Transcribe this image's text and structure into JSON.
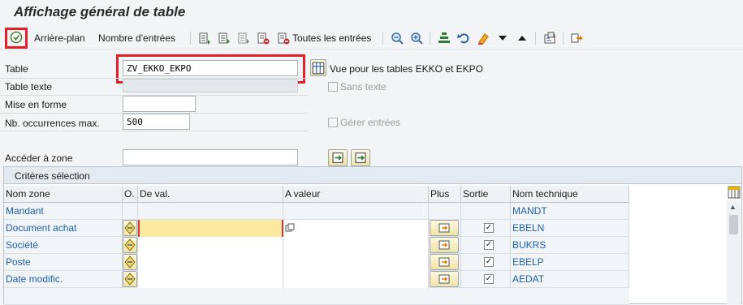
{
  "title": "Affichage général de table",
  "toolbar": {
    "background": "Arrière-plan",
    "entry_count": "Nombre d'entrées",
    "all_entries": "Toutes les entrées"
  },
  "form": {
    "table_label": "Table",
    "table_value": "ZV_EKKO_EKPO",
    "table_description": "Vue pour les tables EKKO et EKPO",
    "table_text_label": "Table texte",
    "no_text_label": "Sans texte",
    "layout_label": "Mise en forme",
    "layout_value": "",
    "max_hits_label": "Nb. occurrences max.",
    "max_hits_value": "500",
    "manage_entries_label": "Gérer entrées",
    "goto_field_label": "Accéder à zone",
    "goto_field_value": ""
  },
  "selection": {
    "header": "Critères sélection",
    "columns": {
      "field_name": "Nom zone",
      "option": "O.",
      "from_value": "De val.",
      "to_value": "A valeur",
      "more": "Plus",
      "output": "Sortie",
      "tech_name": "Nom technique"
    },
    "rows": [
      {
        "name": "Mandant",
        "tech": "MANDT",
        "has_input": false,
        "output": false
      },
      {
        "name": "Document achat",
        "tech": "EBELN",
        "has_input": true,
        "output": true
      },
      {
        "name": "Société",
        "tech": "BUKRS",
        "has_input": true,
        "output": true
      },
      {
        "name": "Poste",
        "tech": "EBELP",
        "has_input": true,
        "output": true
      },
      {
        "name": "Date modific.",
        "tech": "AEDAT",
        "has_input": true,
        "output": true
      }
    ]
  },
  "colors": {
    "highlight": "#e0202a",
    "link_text": "#1d5ea8",
    "focus_field": "#fbeaa0"
  }
}
